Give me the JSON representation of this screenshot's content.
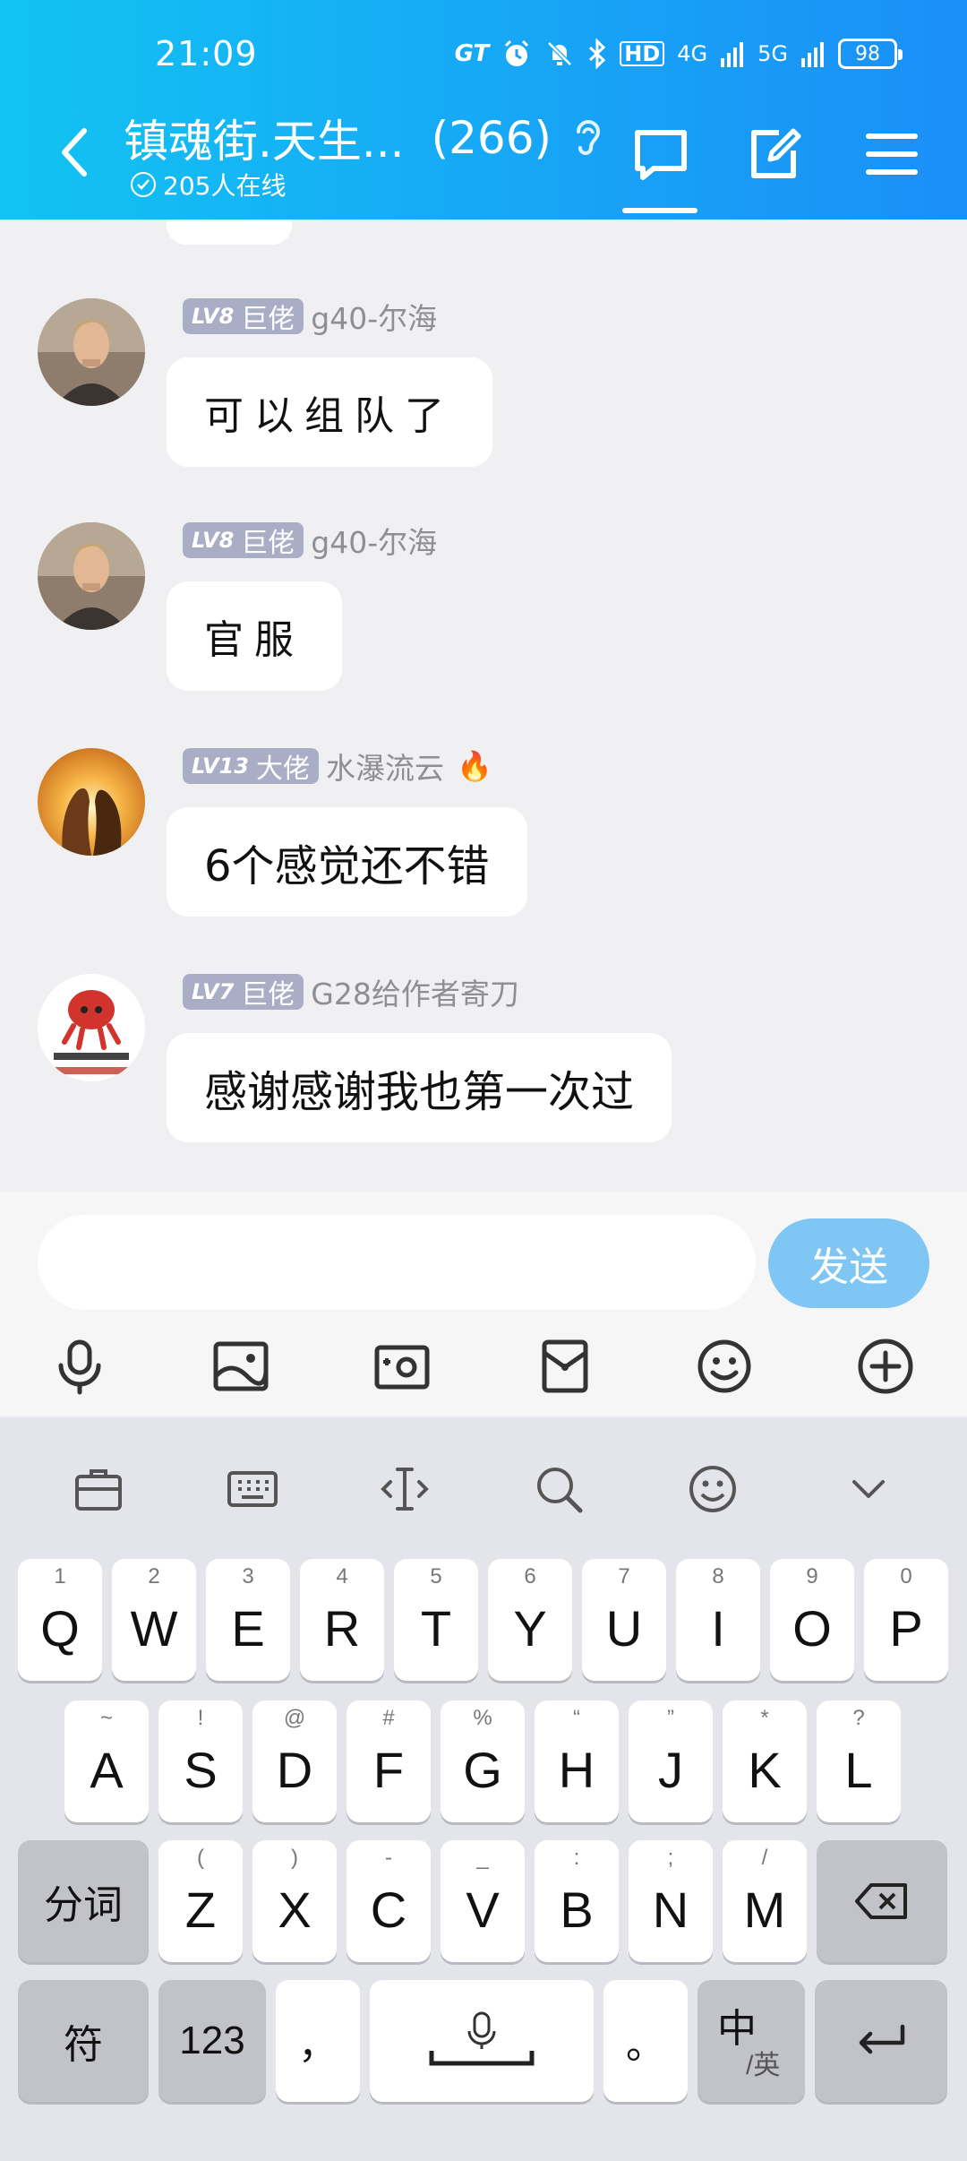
{
  "status_bar": {
    "time": "21:09",
    "carrier_logo": "GT",
    "hd": "HD",
    "net1": "4G",
    "net2": "5G",
    "battery": "98"
  },
  "header": {
    "title": "镇魂街.天生...",
    "member_count": "(266)",
    "online": "205人在线"
  },
  "messages": [
    {
      "level": "LV8",
      "rank": "巨佬",
      "nickname": "g40-尔海",
      "text": "可以组队了",
      "style": "hand",
      "avatar": "man-photo"
    },
    {
      "level": "LV8",
      "rank": "巨佬",
      "nickname": "g40-尔海",
      "text": "官服",
      "style": "hand",
      "avatar": "man-photo"
    },
    {
      "level": "LV13",
      "rank": "大佬",
      "nickname": "水瀑流云",
      "text": "6个感觉还不错",
      "style": "normal",
      "avatar": "couple-sunset",
      "flair": "🔥"
    },
    {
      "level": "LV7",
      "rank": "巨佬",
      "nickname": "G28给作者寄刀",
      "text": "感谢感谢我也第一次过",
      "style": "normal",
      "avatar": "cartoon-sticker"
    }
  ],
  "input": {
    "placeholder": "",
    "value": "",
    "send_label": "发送"
  },
  "keyboard": {
    "row1": [
      {
        "k": "Q",
        "s": "1"
      },
      {
        "k": "W",
        "s": "2"
      },
      {
        "k": "E",
        "s": "3"
      },
      {
        "k": "R",
        "s": "4"
      },
      {
        "k": "T",
        "s": "5"
      },
      {
        "k": "Y",
        "s": "6"
      },
      {
        "k": "U",
        "s": "7"
      },
      {
        "k": "I",
        "s": "8"
      },
      {
        "k": "O",
        "s": "9"
      },
      {
        "k": "P",
        "s": "0"
      }
    ],
    "row2": [
      {
        "k": "A",
        "s": "~"
      },
      {
        "k": "S",
        "s": "!"
      },
      {
        "k": "D",
        "s": "@"
      },
      {
        "k": "F",
        "s": "#"
      },
      {
        "k": "G",
        "s": "%"
      },
      {
        "k": "H",
        "s": "“"
      },
      {
        "k": "J",
        "s": "”"
      },
      {
        "k": "K",
        "s": "*"
      },
      {
        "k": "L",
        "s": "?"
      }
    ],
    "row3": [
      {
        "k": "Z",
        "s": "("
      },
      {
        "k": "X",
        "s": ")"
      },
      {
        "k": "C",
        "s": "-"
      },
      {
        "k": "V",
        "s": "_"
      },
      {
        "k": "B",
        "s": ":"
      },
      {
        "k": "N",
        "s": ";"
      },
      {
        "k": "M",
        "s": "/"
      }
    ],
    "fenci": "分词",
    "fu": "符",
    "num": "123",
    "comma": "，",
    "period": "。",
    "zhong": "中",
    "ying": "/英"
  }
}
